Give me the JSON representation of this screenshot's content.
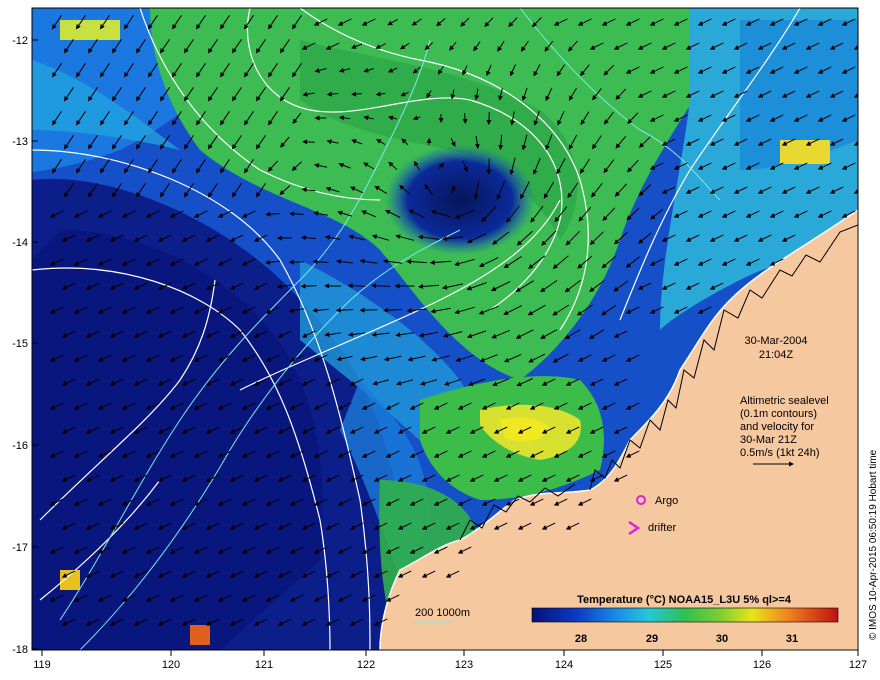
{
  "map": {
    "x_ticks": [
      "119",
      "120",
      "121",
      "122",
      "123",
      "124",
      "125",
      "126",
      "127"
    ],
    "y_ticks": [
      "-12",
      "-13",
      "-14",
      "-15",
      "-16",
      "-17",
      "-18"
    ],
    "datetime_line1": "30-Mar-2004",
    "datetime_line2": "21:04Z",
    "altimetry_lines": [
      "Altimetric sealevel",
      "(0.1m contours)",
      "and velocity for",
      "30-Mar 21Z",
      "0.5m/s (1kt 24h)"
    ],
    "argo_label": "Argo",
    "drifter_label": "drifter",
    "depth_label": "200  1000m",
    "colorbar_title": "Temperature (°C) NOAA15_L3U 5% ql>=4",
    "colorbar_ticks": [
      "28",
      "29",
      "30",
      "31"
    ],
    "credit": "© IMOS 10-Apr-2015 06:50:19 Hobart time",
    "colors": {
      "land": "#f5c8a0",
      "cold": "#0a1a7a",
      "mid": "#1e6fd0",
      "cyan": "#22c0d8",
      "green": "#3fc24a",
      "yellow": "#e8e41a",
      "argo_marker": "#e020e0",
      "contour": "#ffffff",
      "isobath": "#7fe8e8"
    }
  }
}
